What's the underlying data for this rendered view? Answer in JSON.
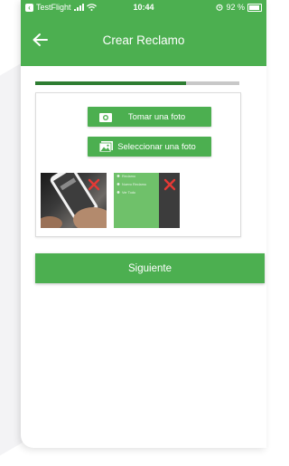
{
  "status_bar": {
    "app_label": "TestFlight",
    "time": "10:44",
    "battery_text": "92 %"
  },
  "header": {
    "title": "Crear Reclamo"
  },
  "progress": {
    "fraction": 0.74
  },
  "photo_actions": {
    "take_photo_label": "Tomar una foto",
    "select_photo_label": "Seleccionar una foto"
  },
  "thumbnail_2": {
    "menu_items": [
      "Reclamo",
      "Nuevo Reclamo",
      "Ver Todo"
    ]
  },
  "footer": {
    "next_label": "Siguiente"
  },
  "colors": {
    "primary": "#4caf50",
    "progress_fill": "#2e7d32",
    "progress_track": "#c8c8c8",
    "remove": "#e53935"
  }
}
